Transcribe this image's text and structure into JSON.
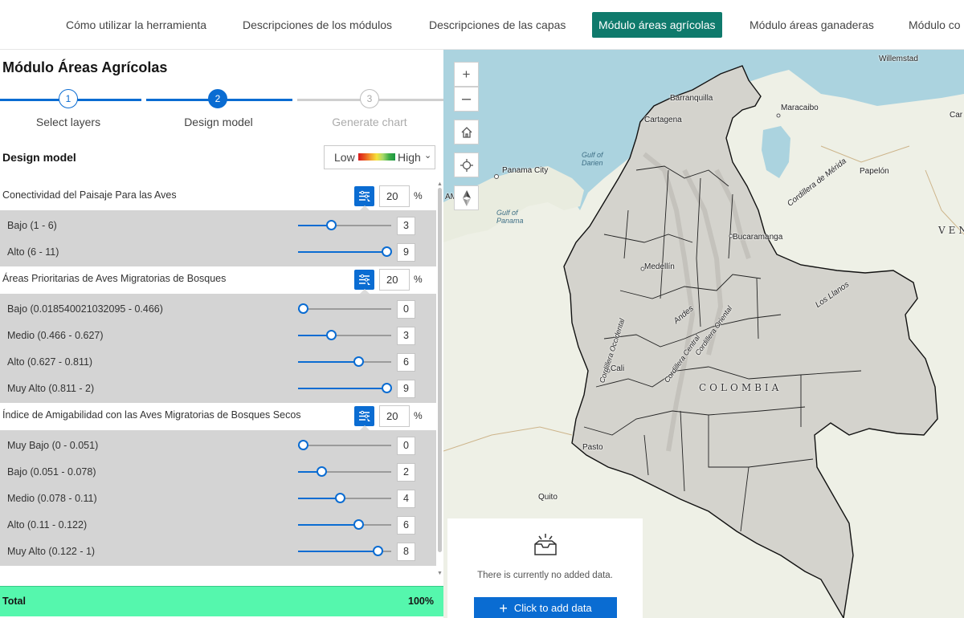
{
  "nav": {
    "tabs": [
      {
        "label": "Cómo utilizar la herramienta",
        "active": false
      },
      {
        "label": "Descripciones de los módulos",
        "active": false
      },
      {
        "label": "Descripciones de las capas",
        "active": false
      },
      {
        "label": "Módulo áreas agrícolas",
        "active": true
      },
      {
        "label": "Módulo áreas ganaderas",
        "active": false
      },
      {
        "label": "Módulo co",
        "active": false
      }
    ]
  },
  "panel": {
    "title": "Módulo Áreas Agrícolas",
    "steps": [
      {
        "number": "1",
        "label": "Select layers",
        "state": "done"
      },
      {
        "number": "2",
        "label": "Design model",
        "state": "active"
      },
      {
        "number": "3",
        "label": "Generate chart",
        "state": "pending"
      }
    ],
    "design_title": "Design model",
    "legend": {
      "low": "Low",
      "high": "High"
    },
    "groups": [
      {
        "name": "Conectividad del Paisaje Para las Aves",
        "percent": "20",
        "breaks": [
          {
            "label": "Bajo (1 - 6)",
            "value": "3",
            "fraction": 0.35
          },
          {
            "label": "Alto (6 - 11)",
            "value": "9",
            "fraction": 0.95
          }
        ]
      },
      {
        "name": "Áreas Prioritarias de Aves Migratorias de Bosques",
        "percent": "20",
        "breaks": [
          {
            "label": "Bajo (0.018540021032095 - 0.466)",
            "value": "0",
            "fraction": 0.05
          },
          {
            "label": "Medio (0.466 - 0.627)",
            "value": "3",
            "fraction": 0.35
          },
          {
            "label": "Alto (0.627 - 0.811)",
            "value": "6",
            "fraction": 0.65
          },
          {
            "label": "Muy Alto (0.811 - 2)",
            "value": "9",
            "fraction": 0.95
          }
        ]
      },
      {
        "name": "Índice de Amigabilidad con las Aves Migratorias de Bosques Secos",
        "percent": "20",
        "breaks": [
          {
            "label": "Muy Bajo (0 - 0.051)",
            "value": "0",
            "fraction": 0.05
          },
          {
            "label": "Bajo (0.051 - 0.078)",
            "value": "2",
            "fraction": 0.25
          },
          {
            "label": "Medio (0.078 - 0.11)",
            "value": "4",
            "fraction": 0.45
          },
          {
            "label": "Alto (0.11 - 0.122)",
            "value": "6",
            "fraction": 0.65
          },
          {
            "label": "Muy Alto (0.122 - 1)",
            "value": "8",
            "fraction": 0.85
          }
        ]
      }
    ],
    "total": {
      "label": "Total",
      "value": "100%"
    }
  },
  "map": {
    "places": {
      "willemstad": "Willemstad",
      "barranquilla": "Barranquilla",
      "cartagena": "Cartagena",
      "maracaibo": "Maracaibo",
      "car": "Car",
      "panama_city": "Panama City",
      "gulf_darien": "Gulf of Darien",
      "gulf_panama": "Gulf of Panama",
      "papelon": "Papelón",
      "cordillera_merida": "Cordillera de Mérida",
      "bucaramanga": "Bucaramanga",
      "ven": "VEN",
      "medellin": "Medellín",
      "los_llanos": "Los Llanos",
      "andes": "Andes",
      "cordillera_occidental": "Cordillera Occidental",
      "cordillera_central": "Cordillera Central",
      "cordillera_oriental": "Cordillera Oriental",
      "cali": "Cali",
      "colombia": "COLOMBIA",
      "pasto": "Pasto",
      "quito": "Quito",
      "am": "AM"
    }
  },
  "adddata": {
    "message": "There is currently no added data.",
    "button": "Click to add data"
  },
  "colors": {
    "accent": "#0a6cd2",
    "active_tab": "#0f7a6c",
    "total_bg": "#55f7ad"
  }
}
